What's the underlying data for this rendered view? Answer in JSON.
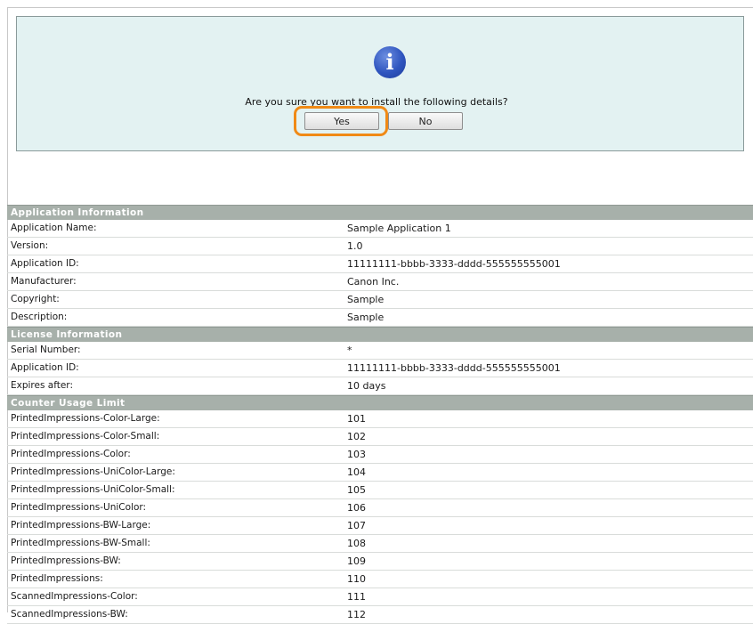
{
  "dialog": {
    "icon": "info-icon",
    "icon_glyph": "i",
    "question": "Are you sure you want to install the following details?",
    "yes_label": "Yes",
    "no_label": "No",
    "highlight_color": "#f08a16"
  },
  "application_information": {
    "header": "Application Information",
    "rows": [
      {
        "label": "Application Name:",
        "value": "Sample Application 1"
      },
      {
        "label": "Version:",
        "value": "1.0"
      },
      {
        "label": "Application ID:",
        "value": "11111111-bbbb-3333-dddd-555555555001"
      },
      {
        "label": "Manufacturer:",
        "value": "Canon Inc."
      },
      {
        "label": "Copyright:",
        "value": "Sample"
      },
      {
        "label": "Description:",
        "value": "Sample"
      }
    ]
  },
  "license_information": {
    "header": "License Information",
    "rows": [
      {
        "label": "Serial Number:",
        "value": "*"
      },
      {
        "label": "Application ID:",
        "value": "11111111-bbbb-3333-dddd-555555555001"
      },
      {
        "label": "Expires after:",
        "value": "10 days"
      }
    ]
  },
  "counter_usage_limit": {
    "header": "Counter Usage Limit",
    "rows": [
      {
        "label": "PrintedImpressions-Color-Large:",
        "value": "101"
      },
      {
        "label": "PrintedImpressions-Color-Small:",
        "value": "102"
      },
      {
        "label": "PrintedImpressions-Color:",
        "value": "103"
      },
      {
        "label": "PrintedImpressions-UniColor-Large:",
        "value": "104"
      },
      {
        "label": "PrintedImpressions-UniColor-Small:",
        "value": "105"
      },
      {
        "label": "PrintedImpressions-UniColor:",
        "value": "106"
      },
      {
        "label": "PrintedImpressions-BW-Large:",
        "value": "107"
      },
      {
        "label": "PrintedImpressions-BW-Small:",
        "value": "108"
      },
      {
        "label": "PrintedImpressions-BW:",
        "value": "109"
      },
      {
        "label": "PrintedImpressions:",
        "value": "110"
      },
      {
        "label": "ScannedImpressions-Color:",
        "value": "111"
      },
      {
        "label": "ScannedImpressions-BW:",
        "value": "112"
      }
    ]
  }
}
